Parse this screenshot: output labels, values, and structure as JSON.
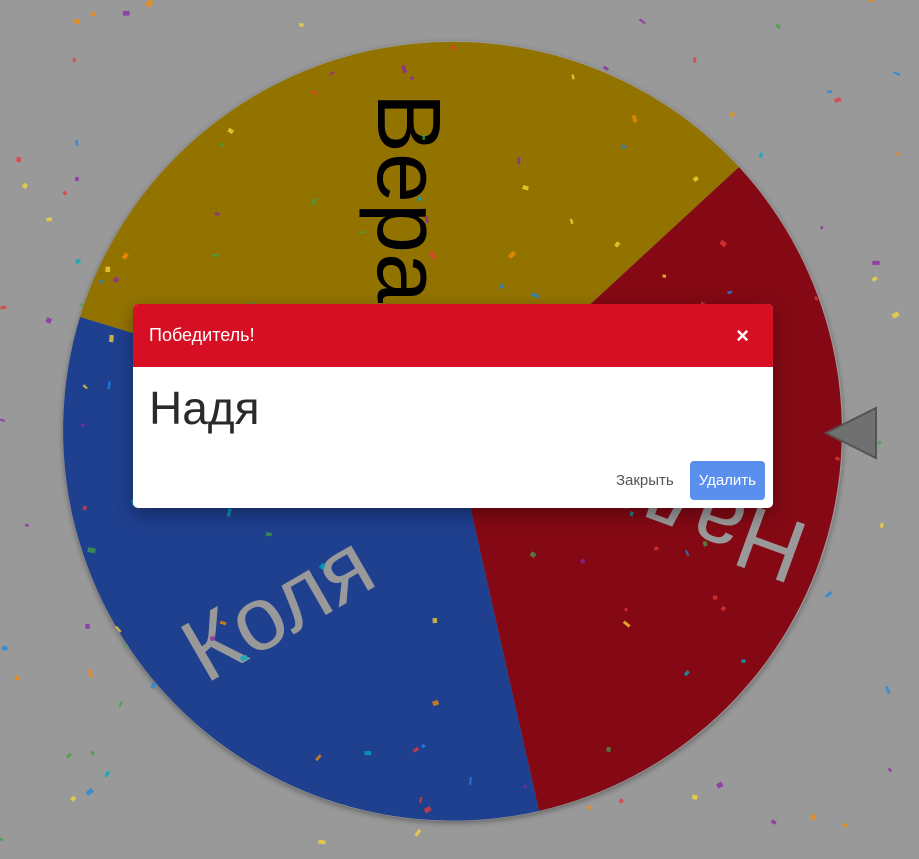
{
  "wheel": {
    "segments": [
      {
        "label": "Вера",
        "color": "#f5c000",
        "text_color": "#000000"
      },
      {
        "label": "Надя",
        "color": "#dd0f22",
        "text_color": "#ffffff"
      },
      {
        "label": "Коля",
        "color": "#3469ee",
        "text_color": "#ffffff"
      }
    ],
    "pointer": "pointer-triangle-icon"
  },
  "colors": {
    "modal_header": "#d60f24",
    "primary_button": "#5b8fee",
    "overlay": "rgba(0,0,0,0.40)"
  },
  "modal": {
    "title": "Победитель!",
    "close_icon": "×",
    "winner": "Надя",
    "close_label": "Закрыть",
    "delete_label": "Удалить"
  }
}
